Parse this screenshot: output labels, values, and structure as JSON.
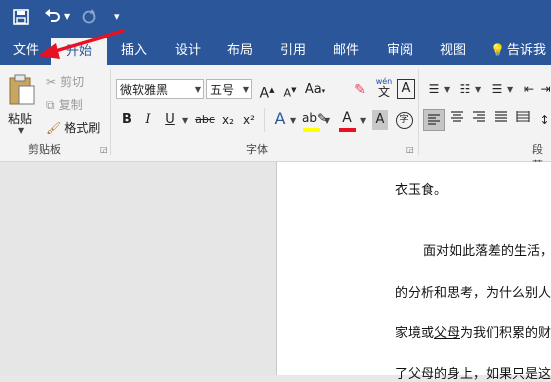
{
  "quick_access": {
    "save": "save-icon",
    "undo": "undo-icon",
    "redo": "redo-icon",
    "customize": "customize-icon"
  },
  "tabs": [
    {
      "label": "文件"
    },
    {
      "label": "开始"
    },
    {
      "label": "插入"
    },
    {
      "label": "设计"
    },
    {
      "label": "布局"
    },
    {
      "label": "引用"
    },
    {
      "label": "邮件"
    },
    {
      "label": "审阅"
    },
    {
      "label": "视图"
    },
    {
      "label": "告诉我"
    }
  ],
  "clipboard": {
    "paste": "粘贴",
    "cut": "剪切",
    "copy": "复制",
    "format_painter": "格式刷",
    "group_label": "剪贴板"
  },
  "font": {
    "name": "微软雅黑",
    "size": "五号",
    "group_label": "字体",
    "phonetic_top": "wén",
    "phonetic_char": "文",
    "bold": "B",
    "italic": "I",
    "underline": "U",
    "strike": "abc",
    "subscript": "x₂",
    "superscript": "x²"
  },
  "paragraph": {
    "group_label": "段落"
  },
  "document": {
    "lines": [
      "衣玉食。",
      "面对如此落差的生活，",
      "的分析和思考，为什么别人",
      "家境或父母为我们积累的财",
      "了父母的身上，如果只是这"
    ],
    "underlined_word": "父母"
  },
  "colors": {
    "brand": "#2b579a",
    "arrow": "#e81123",
    "highlight": "#ffff00",
    "font_color": "#e81123"
  }
}
